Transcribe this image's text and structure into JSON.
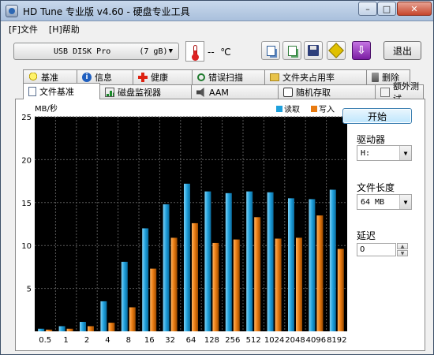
{
  "window": {
    "title": "HD Tune 专业版 v4.60 - 硬盘专业工具",
    "controls": {
      "minimize": "–",
      "maximize": "□",
      "close": "✕"
    }
  },
  "menu": [
    "[F]文件",
    "[H]帮助"
  ],
  "toolbar": {
    "drive": "USB DISK Pro      (7 gB)",
    "temperature": "--  ℃",
    "exit_label": "退出",
    "icons": [
      "copy-text-icon",
      "copy-screenshot-icon",
      "save-icon",
      "options-icon",
      "download-icon"
    ]
  },
  "tabs_row1": [
    {
      "label": "基准",
      "icon": "bulb-icon"
    },
    {
      "label": "信息",
      "icon": "info-icon"
    },
    {
      "label": "健康",
      "icon": "health-cross-icon"
    },
    {
      "label": "错误扫描",
      "icon": "magnifier-icon"
    },
    {
      "label": "文件夹占用率",
      "icon": "folder-icon"
    },
    {
      "label": "删除",
      "icon": "trash-icon"
    }
  ],
  "tabs_row2": [
    {
      "label": "文件基准",
      "icon": "document-icon",
      "active": true
    },
    {
      "label": "磁盘监视器",
      "icon": "graph-icon"
    },
    {
      "label": "AAM",
      "icon": "speaker-icon"
    },
    {
      "label": "随机存取",
      "icon": "dice-icon"
    },
    {
      "label": "额外测试",
      "icon": "plus-icon"
    }
  ],
  "controls": {
    "start_label": "开始",
    "drive_label": "驱动器",
    "drive_value": "H:",
    "file_length_label": "文件长度",
    "file_length_value": "64 MB",
    "delay_label": "延迟",
    "delay_value": "0"
  },
  "chart_data": {
    "type": "bar",
    "ylabel": "MB/秒",
    "ylim": [
      0,
      25
    ],
    "yticks": [
      5,
      10,
      15,
      20,
      25
    ],
    "categories": [
      "0.5",
      "1",
      "2",
      "4",
      "8",
      "16",
      "32",
      "64",
      "128",
      "256",
      "512",
      "1024",
      "2048",
      "4096",
      "8192"
    ],
    "series": [
      {
        "name": "读取",
        "color": "#1ea0dc",
        "values": [
          0.3,
          0.6,
          1.1,
          3.5,
          8.1,
          12.0,
          14.8,
          17.2,
          16.3,
          16.1,
          16.3,
          16.2,
          15.5,
          15.4,
          16.5
        ]
      },
      {
        "name": "写入",
        "color": "#e87a10",
        "values": [
          0.2,
          0.3,
          0.6,
          1.0,
          2.8,
          7.3,
          10.9,
          12.6,
          10.3,
          10.7,
          13.3,
          10.8,
          10.9,
          13.5,
          9.6
        ]
      }
    ],
    "grid": true,
    "legend": "top-right",
    "background": "#000000",
    "xlabel": ""
  }
}
